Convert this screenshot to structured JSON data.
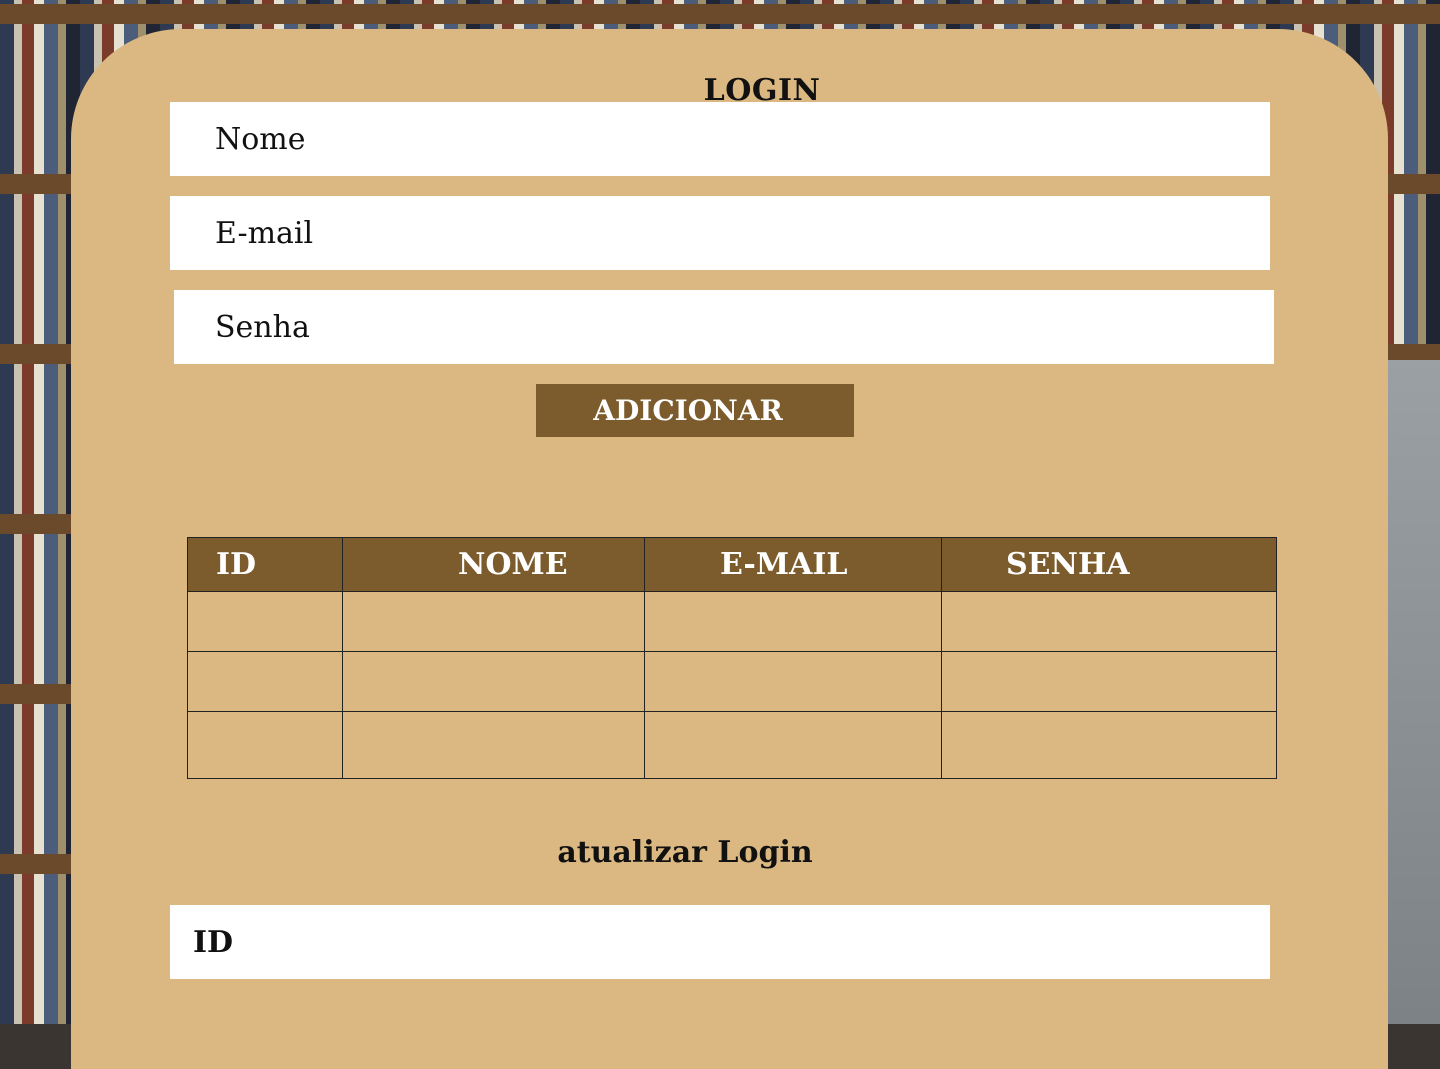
{
  "form": {
    "title": "LOGIN",
    "nome_placeholder": "Nome",
    "email_placeholder": "E-mail",
    "senha_placeholder": "Senha",
    "add_label": "ADICIONAR"
  },
  "table": {
    "headers": [
      "ID",
      "NOME",
      "E-MAIL",
      "SENHA"
    ],
    "rows": [
      [
        "",
        "",
        "",
        ""
      ],
      [
        "",
        "",
        "",
        ""
      ],
      [
        "",
        "",
        "",
        ""
      ]
    ]
  },
  "update": {
    "title": "atualizar Login",
    "id_placeholder": "ID"
  },
  "colors": {
    "panel": "#dbb881",
    "accent": "#7c5c2c",
    "field": "#ffffff"
  }
}
